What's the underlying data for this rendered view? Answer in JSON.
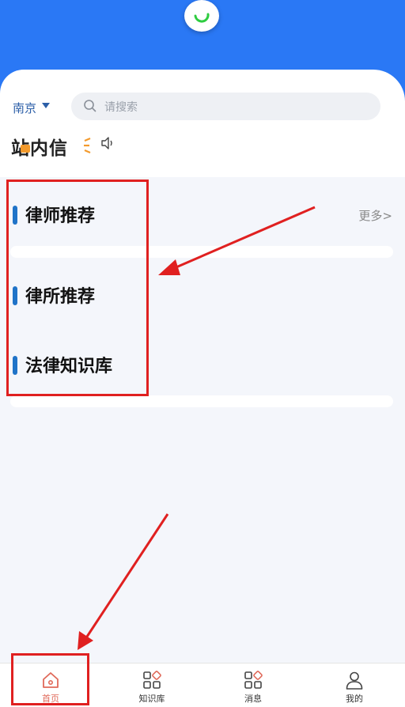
{
  "header": {
    "city": "南京",
    "search_placeholder": "请搜索"
  },
  "inbox": {
    "logo_text": "站内信"
  },
  "sections": [
    {
      "title": "律师推荐",
      "more": "更多>"
    },
    {
      "title": "律所推荐"
    },
    {
      "title": "法律知识库"
    }
  ],
  "tabs": [
    {
      "label": "首页",
      "icon": "home-icon",
      "active": true
    },
    {
      "label": "知识库",
      "icon": "grid-icon"
    },
    {
      "label": "消息",
      "icon": "grid-icon"
    },
    {
      "label": "我的",
      "icon": "user-icon"
    }
  ],
  "colors": {
    "brand": "#2a78f5",
    "accent_bar": "#1f73c8",
    "annotation": "#e02020",
    "active_tab": "#e06a5a",
    "inbox_accent": "#f39a2c"
  }
}
